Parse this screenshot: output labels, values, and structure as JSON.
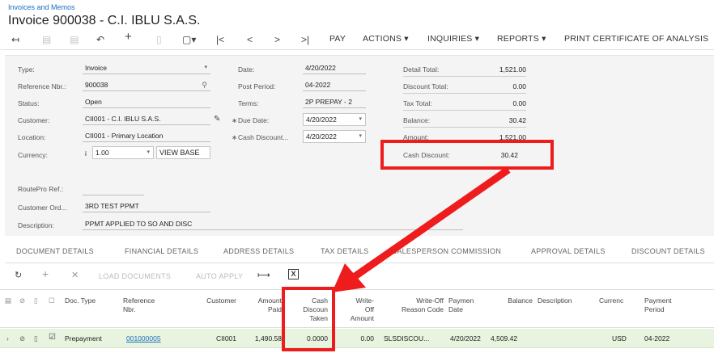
{
  "breadcrumb": "Invoices and Memos",
  "title": "Invoice 900038 - C.I. IBLU S.A.S.",
  "toolbar": {
    "pay": "PAY",
    "actions": "ACTIONS ▾",
    "inquiries": "INQUIRIES ▾",
    "reports": "REPORTS ▾",
    "print": "PRINT CERTIFICATE OF ANALYSIS"
  },
  "form": {
    "type_label": "Type:",
    "type_value": "Invoice",
    "ref_label": "Reference Nbr.:",
    "ref_value": "900038",
    "status_label": "Status:",
    "status_value": "Open",
    "customer_label": "Customer:",
    "customer_value": "CII001 - C.I. IBLU S.A.S.",
    "location_label": "Location:",
    "location_value": "CII001 - Primary Location",
    "currency_label": "Currency:",
    "currency_code": "i",
    "currency_rate": "1.00",
    "view_base": "VIEW BASE",
    "date_label": "Date:",
    "date_value": "4/20/2022",
    "post_period_label": "Post Period:",
    "post_period_value": "04-2022",
    "terms_label": "Terms:",
    "terms_value": "2P PREPAY - 2",
    "due_date_label": "Due Date:",
    "due_date_value": "4/20/2022",
    "cash_discount_date_label": "Cash Discount...",
    "cash_discount_date_value": "4/20/2022",
    "detail_total_label": "Detail Total:",
    "detail_total_value": "1,521.00",
    "discount_total_label": "Discount Total:",
    "discount_total_value": "0.00",
    "tax_total_label": "Tax Total:",
    "tax_total_value": "0.00",
    "balance_label": "Balance:",
    "balance_value": "30.42",
    "amount_label": "Amount:",
    "amount_value": "1,521.00",
    "cash_discount_label": "Cash Discount:",
    "cash_discount_value": "30.42",
    "routepro_label": "RoutePro Ref.:",
    "customer_order_label": "Customer Ord...",
    "customer_order_value": "3RD TEST PPMT",
    "description_label": "Description:",
    "description_value": "PPMT APPLIED TO SO AND DISC"
  },
  "tabs": [
    "DOCUMENT DETAILS",
    "FINANCIAL DETAILS",
    "ADDRESS DETAILS",
    "TAX DETAILS",
    "SALESPERSON COMMISSION",
    "APPROVAL DETAILS",
    "DISCOUNT DETAILS"
  ],
  "grid_toolbar": {
    "load": "LOAD DOCUMENTS",
    "auto": "AUTO APPLY"
  },
  "grid": {
    "headers": {
      "doc_type": "Doc. Type",
      "ref_nbr": "Reference\nNbr.",
      "customer": "Customer",
      "amount_paid": "Amount\nPaid",
      "cash_disc": "Cash\nDiscoun\nTaken",
      "write_off": "Write-\nOff\nAmount",
      "write_off_reason": "Write-Off\nReason Code",
      "payment_date": "Paymen\nDate",
      "balance": "Balance",
      "description": "Description",
      "currency": "Currenc",
      "payment_period": "Payment\nPeriod"
    },
    "row": {
      "doc_type": "Prepayment",
      "ref_nbr": "001000005",
      "customer": "CII001",
      "amount_paid": "1,490.58",
      "cash_disc": "0.0000",
      "write_off": "0.00",
      "write_off_reason": "SLSDISCOU...",
      "payment_date": "4/20/2022",
      "balance": "4,509.42",
      "description": "",
      "currency": "USD",
      "payment_period": "04-2022"
    }
  },
  "colors": {
    "highlight": "#ee1c1c",
    "link": "#1a6ec2",
    "row_bg": "#e8f4df"
  }
}
